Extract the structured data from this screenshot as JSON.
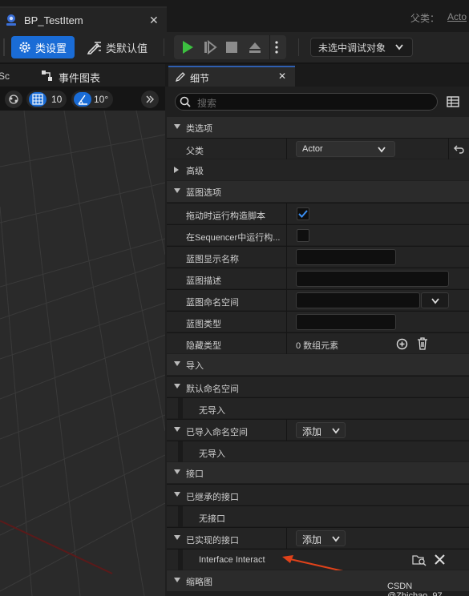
{
  "window": {
    "tab_title": "BP_TestItem",
    "parent_label": "父类：",
    "parent_value": "Acto"
  },
  "toolbar": {
    "class_settings": "类设置",
    "class_defaults": "类默认值",
    "debug_object": "未选中调试对象"
  },
  "left_panel": {
    "tab_partial": "Sc",
    "event_graph_tab": "事件图表",
    "grid_snap": "10",
    "angle_snap": "10°"
  },
  "details": {
    "tab_label": "细节",
    "search_placeholder": "搜索",
    "categories": {
      "class_options": "类选项",
      "advanced": "高级",
      "blueprint_options": "蓝图选项",
      "imports": "导入",
      "interfaces": "接口",
      "thumbnail": "缩略图"
    },
    "rows": {
      "parent_class_label": "父类",
      "parent_class_value": "Actor",
      "run_construction_label": "拖动时运行构造脚本",
      "run_construction_checked": true,
      "run_in_sequencer_label": "在Sequencer中运行构...",
      "run_in_sequencer_checked": false,
      "display_name_label": "蓝图显示名称",
      "description_label": "蓝图描述",
      "namespace_label": "蓝图命名空间",
      "type_label": "蓝图类型",
      "hide_categories_label": "隐藏类型",
      "hide_categories_value": "0 数组元素",
      "default_namespaces_label": "默认命名空间",
      "no_imports_1": "无导入",
      "imported_namespaces_label": "已导入命名空间",
      "add_label_1": "添加",
      "no_imports_2": "无导入",
      "inherited_interfaces_label": "已继承的接口",
      "no_interfaces": "无接口",
      "implemented_interfaces_label": "已实现的接口",
      "add_label_2": "添加",
      "interface_item": "Interface Interact"
    }
  },
  "watermark": "CSDN @Zhichao_97",
  "colors": {
    "accent": "#1a6cd6",
    "play_green": "#3cc040",
    "annotation_arrow": "#e0421a"
  }
}
